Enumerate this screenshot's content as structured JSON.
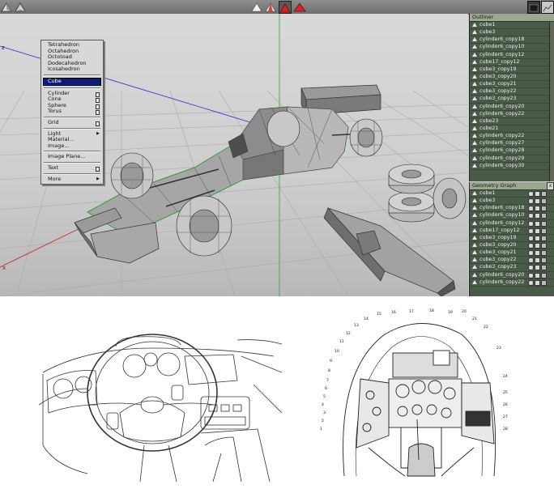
{
  "context_menu": {
    "items": [
      {
        "label": "Tetrahedron"
      },
      {
        "label": "Octahedron"
      },
      {
        "label": "Octotoad"
      },
      {
        "label": "Dodecahedron"
      },
      {
        "label": "Icosahedron"
      },
      {
        "sep": true
      },
      {
        "label": "Cube",
        "selected": true
      },
      {
        "sep": true
      },
      {
        "label": "Cylinder",
        "box": true
      },
      {
        "label": "Cone",
        "box": true
      },
      {
        "label": "Sphere",
        "box": true
      },
      {
        "label": "Torus",
        "box": true
      },
      {
        "sep": true
      },
      {
        "label": "Grid",
        "box": true
      },
      {
        "sep": true
      },
      {
        "label": "Light",
        "arrow": true
      },
      {
        "label": "Material..."
      },
      {
        "label": "Image..."
      },
      {
        "sep": true
      },
      {
        "label": "Image Plane..."
      },
      {
        "sep": true
      },
      {
        "label": "Text",
        "box": true
      },
      {
        "sep": true
      },
      {
        "label": "More",
        "arrow": true
      }
    ]
  },
  "axes": {
    "z": "z",
    "x": "x"
  },
  "outliner": {
    "title": "Outliner",
    "items": [
      "cube1",
      "cube3",
      "cylinder6_copy18",
      "cylinder6_copy10",
      "cylinder6_copy12",
      "cube17_copy12",
      "cube3_copy19",
      "cube3_copy20",
      "cube3_copy21",
      "cube3_copy22",
      "cube3_copy23",
      "cylinder6_copy20",
      "cylinder6_copy22",
      "cube23",
      "cube21",
      "cylinder6_copy22",
      "cylinder6_copy27",
      "cylinder6_copy28",
      "cylinder6_copy29",
      "cylinder6_copy30"
    ]
  },
  "geometry_graph": {
    "title": "Geometry Graph",
    "close": "x",
    "items": [
      "cube1",
      "cube3",
      "cylinder6_copy18",
      "cylinder6_copy10",
      "cylinder6_copy12",
      "cube17_copy12",
      "cube3_copy19",
      "cube3_copy20",
      "cube3_copy21",
      "cube3_copy22",
      "cube3_copy23",
      "cylinder6_copy20",
      "cylinder6_copy22"
    ]
  },
  "cockpit_labels": [
    "1",
    "2",
    "3",
    "4",
    "5",
    "6",
    "7",
    "8",
    "9",
    "10",
    "11",
    "12",
    "13",
    "14",
    "15",
    "16",
    "17",
    "18",
    "19",
    "20",
    "21",
    "22",
    "23",
    "24",
    "25",
    "26",
    "27",
    "28"
  ],
  "colors": {
    "selection": "#3aa83a",
    "menu_highlight": "#0a1f7a",
    "panel": "#4a5a48",
    "z_axis": "#2a2ae0",
    "x_axis": "#d02020",
    "y_axis": "#20b020"
  }
}
